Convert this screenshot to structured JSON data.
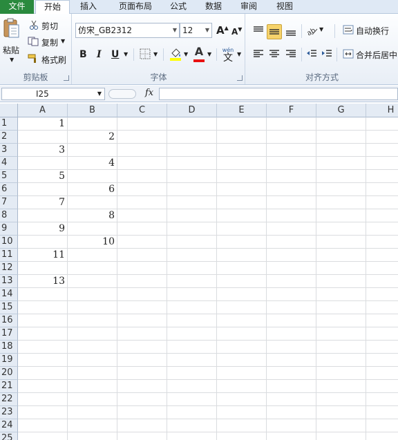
{
  "tabs": [
    "文件",
    "开始",
    "插入",
    "页面布局",
    "公式",
    "数据",
    "审阅",
    "视图"
  ],
  "clipboard": {
    "label": "剪贴板",
    "paste": "粘贴",
    "cut": "剪切",
    "copy": "复制",
    "format_painter": "格式刷"
  },
  "font": {
    "label": "字体",
    "name": "仿宋_GB2312",
    "size": "12",
    "bold": "B",
    "italic": "I",
    "underline": "U",
    "font_color_glyph": "A",
    "grow_glyph": "A",
    "shrink_glyph": "A",
    "phonetic_glyph": "文",
    "phonetic_top": "wén"
  },
  "alignment": {
    "label": "对齐方式",
    "wrap": "自动换行",
    "merge": "合并后居中"
  },
  "formula_bar": {
    "name_box": "I25",
    "fx": "fx",
    "formula": ""
  },
  "columns": [
    "A",
    "B",
    "C",
    "D",
    "E",
    "F",
    "G",
    "H"
  ],
  "rows": [
    "1",
    "2",
    "3",
    "4",
    "5",
    "6",
    "7",
    "8",
    "9",
    "10",
    "11",
    "12",
    "13",
    "14",
    "15",
    "16",
    "17",
    "18",
    "19",
    "20",
    "21",
    "22",
    "23",
    "24",
    "25"
  ],
  "cells": {
    "A1": "1",
    "B2": "2",
    "A3": "3",
    "B4": "4",
    "A5": "5",
    "B6": "6",
    "A7": "7",
    "B8": "8",
    "A9": "9",
    "B10": "10",
    "A11": "11",
    "A13": "13"
  },
  "colors": {
    "file_tab": "#2a8a3e",
    "highlight": "#ffff00",
    "font_color": "#e81010",
    "accent_active": "#f6d36b"
  }
}
